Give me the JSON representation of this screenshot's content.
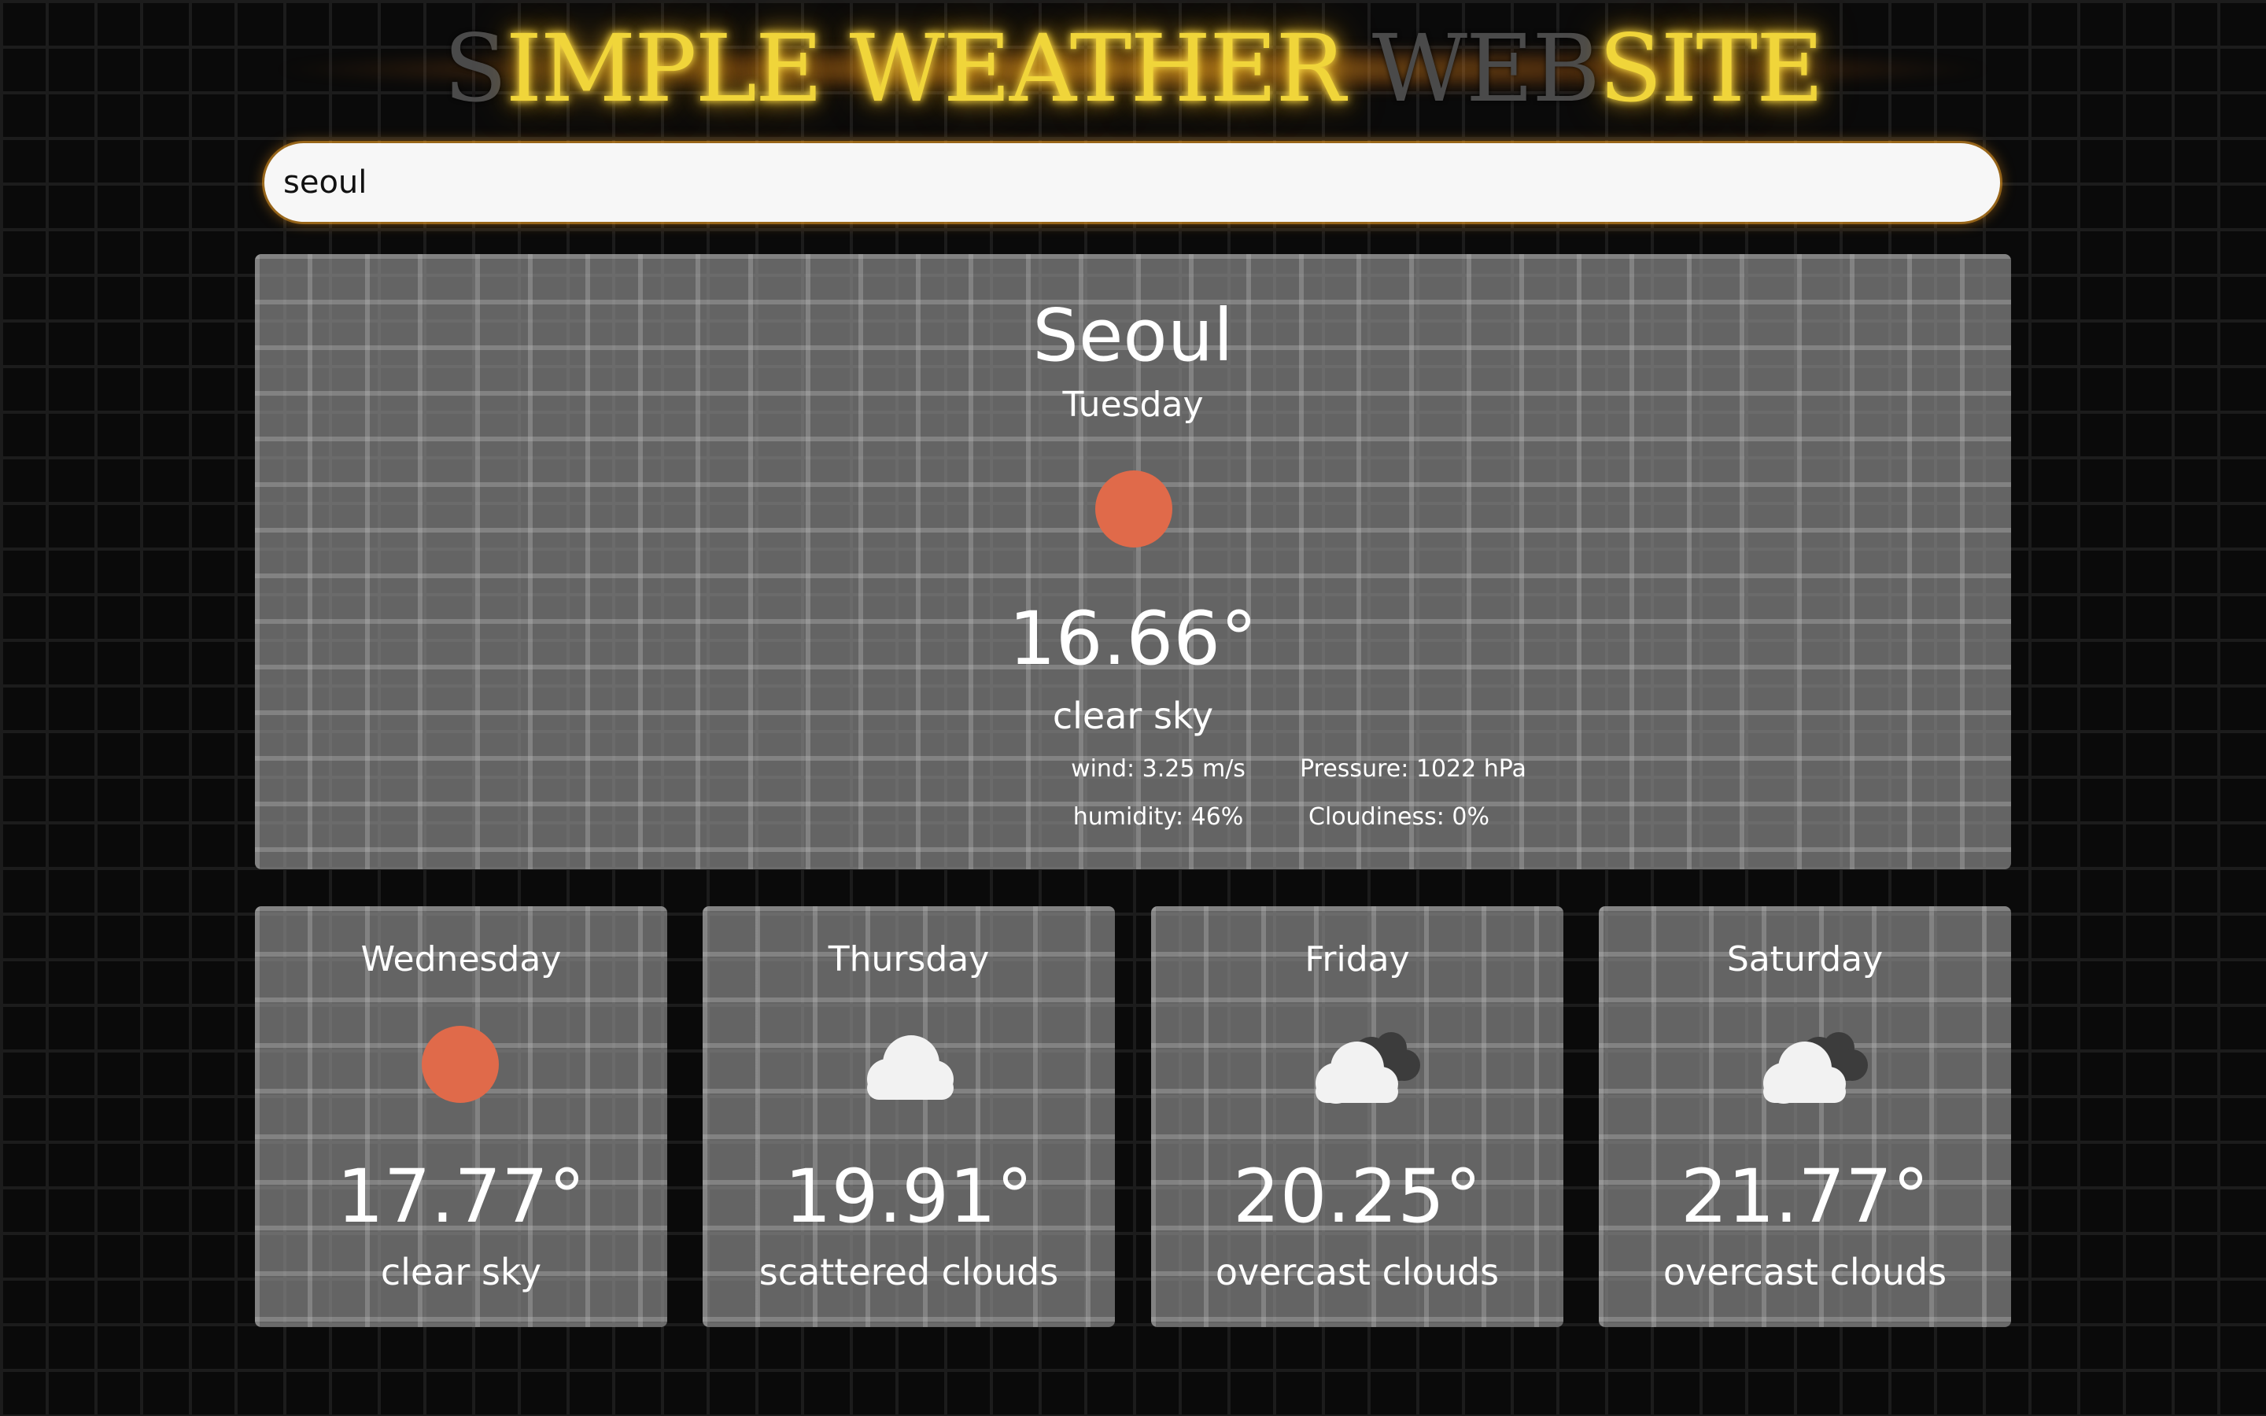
{
  "header": {
    "title_part1": "S",
    "title_part2": "IMPLE WEATHER ",
    "title_part3": "WEB",
    "title_part4": "SITE"
  },
  "search": {
    "value": "seoul",
    "placeholder": ""
  },
  "current": {
    "city": "Seoul",
    "day": "Tuesday",
    "icon": "sun-icon",
    "temperature": "16.66°",
    "description": "clear sky",
    "wind": "wind: 3.25 m/s",
    "pressure": "Pressure: 1022 hPa",
    "humidity": "humidity: 46%",
    "cloudiness": "Cloudiness: 0%"
  },
  "forecast": [
    {
      "day": "Wednesday",
      "icon": "sun-icon",
      "temperature": "17.77°",
      "description": "clear sky"
    },
    {
      "day": "Thursday",
      "icon": "cloud-icon",
      "temperature": "19.91°",
      "description": "scattered clouds"
    },
    {
      "day": "Friday",
      "icon": "overcast-clouds-icon",
      "temperature": "20.25°",
      "description": "overcast clouds"
    },
    {
      "day": "Saturday",
      "icon": "overcast-clouds-icon",
      "temperature": "21.77°",
      "description": "overcast clouds"
    }
  ],
  "colors": {
    "title_lit": "#f0d53a",
    "title_unlit": "#4a4a4a",
    "sun": "#e06a4a",
    "card": "#8a8a8a"
  }
}
